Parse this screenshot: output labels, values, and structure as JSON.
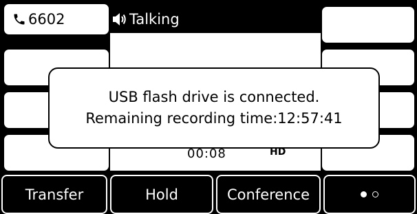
{
  "line_keys": {
    "left": [
      {
        "label": "6602",
        "icon": "phone-handset-icon"
      },
      {
        "label": ""
      },
      {
        "label": ""
      },
      {
        "label": ""
      }
    ],
    "right": [
      {
        "label": ""
      },
      {
        "label": ""
      },
      {
        "label": ""
      },
      {
        "label": ""
      }
    ]
  },
  "call": {
    "status_icon": "speaker-volume-icon",
    "status": "Talking",
    "duration": "00:08",
    "hd_badge": "HD"
  },
  "dialog": {
    "line1": "USB flash drive is connected.",
    "line2": "Remaining recording time:12:57:41"
  },
  "softkeys": {
    "transfer": "Transfer",
    "hold": "Hold",
    "conference": "Conference",
    "more_icon": "page-dots-icon"
  },
  "colors": {
    "background": "#000000",
    "panel": "#ffffff",
    "text_dark": "#000000",
    "text_light": "#ffffff"
  }
}
